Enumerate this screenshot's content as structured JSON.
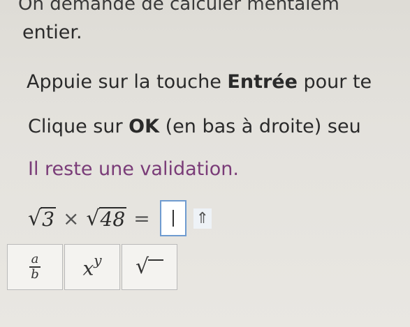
{
  "instructions": {
    "line1": "On demande de calculer mentalem",
    "line2": "entier.",
    "line3_before": "Appuie sur la touche ",
    "line3_bold": "Entrée",
    "line3_after": " pour te",
    "line4_before": "Clique sur ",
    "line4_bold": "OK",
    "line4_after": " (en bas à droite) seu",
    "line5": "Il reste une validation."
  },
  "expression": {
    "radicand1": "3",
    "times": "×",
    "radicand2": "48",
    "equals": "=",
    "answer_value": "",
    "arrow_glyph": "⇑"
  },
  "keypad": {
    "fraction": {
      "numerator": "a",
      "denominator": "b"
    },
    "power": {
      "base": "x",
      "exponent": "y"
    },
    "sqrt_symbol": "√"
  },
  "colors": {
    "remaining_text": "#7a3c78",
    "answer_border": "#6f9bd0"
  }
}
